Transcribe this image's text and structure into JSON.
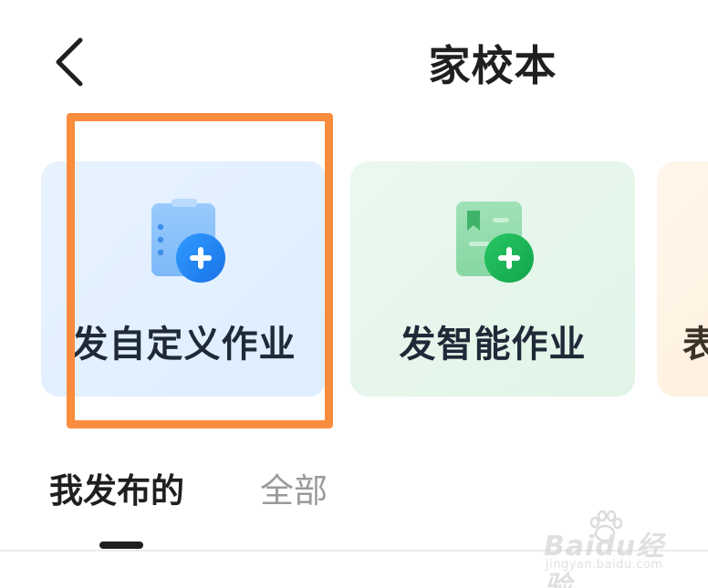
{
  "header": {
    "title": "家校本",
    "back_icon": "chevron-left-icon"
  },
  "cards": [
    {
      "label": "发自定义作业",
      "icon": "clipboard-add-icon",
      "color": "#2f8df5"
    },
    {
      "label": "发智能作业",
      "icon": "bookmark-add-icon",
      "color": "#1fb85a"
    },
    {
      "label": "表",
      "icon": "",
      "color": "#f5a94a"
    }
  ],
  "tabs": [
    {
      "label": "我发布的",
      "active": true
    },
    {
      "label": "全部",
      "active": false
    }
  ],
  "highlight": {
    "color": "#fb8c3d"
  },
  "watermark": {
    "logo": "Baidu经验",
    "sub": "jingyan.baidu.com"
  }
}
